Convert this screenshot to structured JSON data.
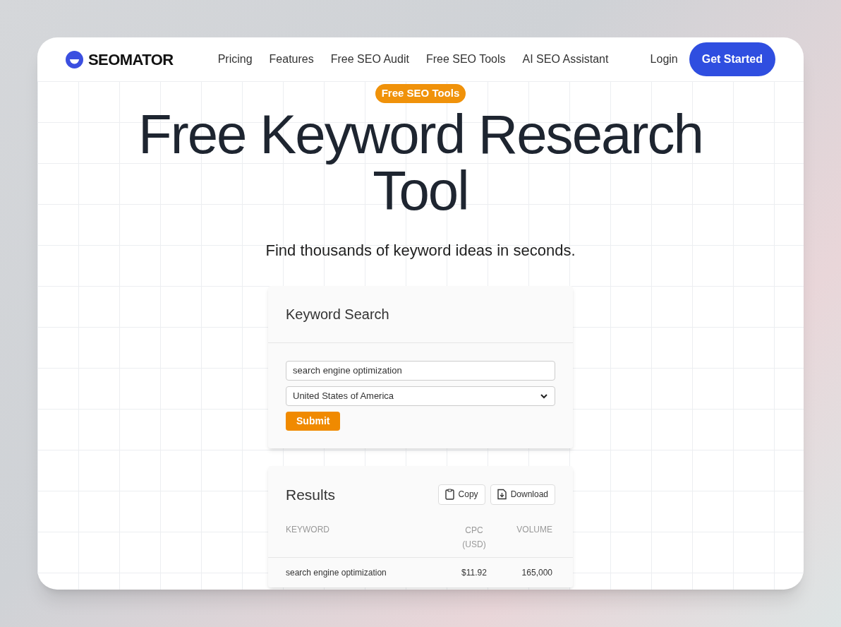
{
  "brand": "SEOMATOR",
  "nav": [
    "Pricing",
    "Features",
    "Free SEO Audit",
    "Free SEO Tools",
    "AI SEO Assistant"
  ],
  "login": "Login",
  "cta": "Get Started",
  "badge": "Free SEO Tools",
  "headline": "Free Keyword Research Tool",
  "subtitle": "Find thousands of keyword ideas in seconds.",
  "search_card": {
    "title": "Keyword Search",
    "keyword": "search engine optimization",
    "country": "United States of America",
    "submit": "Submit"
  },
  "results": {
    "title": "Results",
    "buttons": [
      {
        "label": "Copy",
        "kind": "copy"
      },
      {
        "label": "Download",
        "kind": "download"
      }
    ],
    "columns": [
      "KEYWORD",
      "CPC (USD)",
      "VOLUME"
    ],
    "rows": [
      [
        "search engine optimization",
        "$11.92",
        "165,000"
      ]
    ]
  }
}
